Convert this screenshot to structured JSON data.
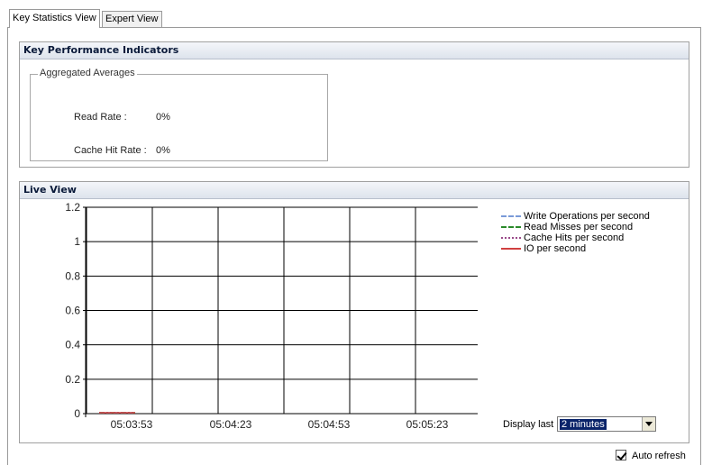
{
  "tabs": [
    {
      "label": "Key Statistics View",
      "active": true
    },
    {
      "label": "Expert View",
      "active": false
    }
  ],
  "kpi_panel": {
    "title": "Key Performance Indicators",
    "group_title": "Aggregated Averages",
    "read_rate_label": "Read Rate :",
    "read_rate_value": "0%",
    "cache_hit_label": "Cache Hit Rate :",
    "cache_hit_value": "0%"
  },
  "live_panel": {
    "title": "Live View",
    "display_last_label": "Display last",
    "display_last_value": "2 minutes",
    "auto_refresh_label": "Auto refresh",
    "auto_refresh_checked": true
  },
  "chart_data": {
    "type": "line",
    "y_ticks": [
      "0",
      "0.2",
      "0.4",
      "0.6",
      "0.8",
      "1",
      "1.2"
    ],
    "ylim": [
      0,
      1.2
    ],
    "x_ticks": [
      "05:03:53",
      "05:04:23",
      "05:04:53",
      "05:05:23"
    ],
    "grid": true,
    "legend_position": "right",
    "series": [
      {
        "name": "Write Operations per second",
        "color": "#7a9ad8",
        "dash": "dash",
        "values": [
          0,
          0
        ]
      },
      {
        "name": "Read Misses per second",
        "color": "#2a8a2a",
        "dash": "dashdot",
        "values": [
          0,
          0
        ]
      },
      {
        "name": "Cache Hits per second",
        "color": "#9a4a8a",
        "dash": "dot",
        "values": [
          0,
          0
        ]
      },
      {
        "name": "IO per second",
        "color": "#d04040",
        "dash": "solid",
        "values": [
          0,
          0
        ]
      }
    ]
  }
}
